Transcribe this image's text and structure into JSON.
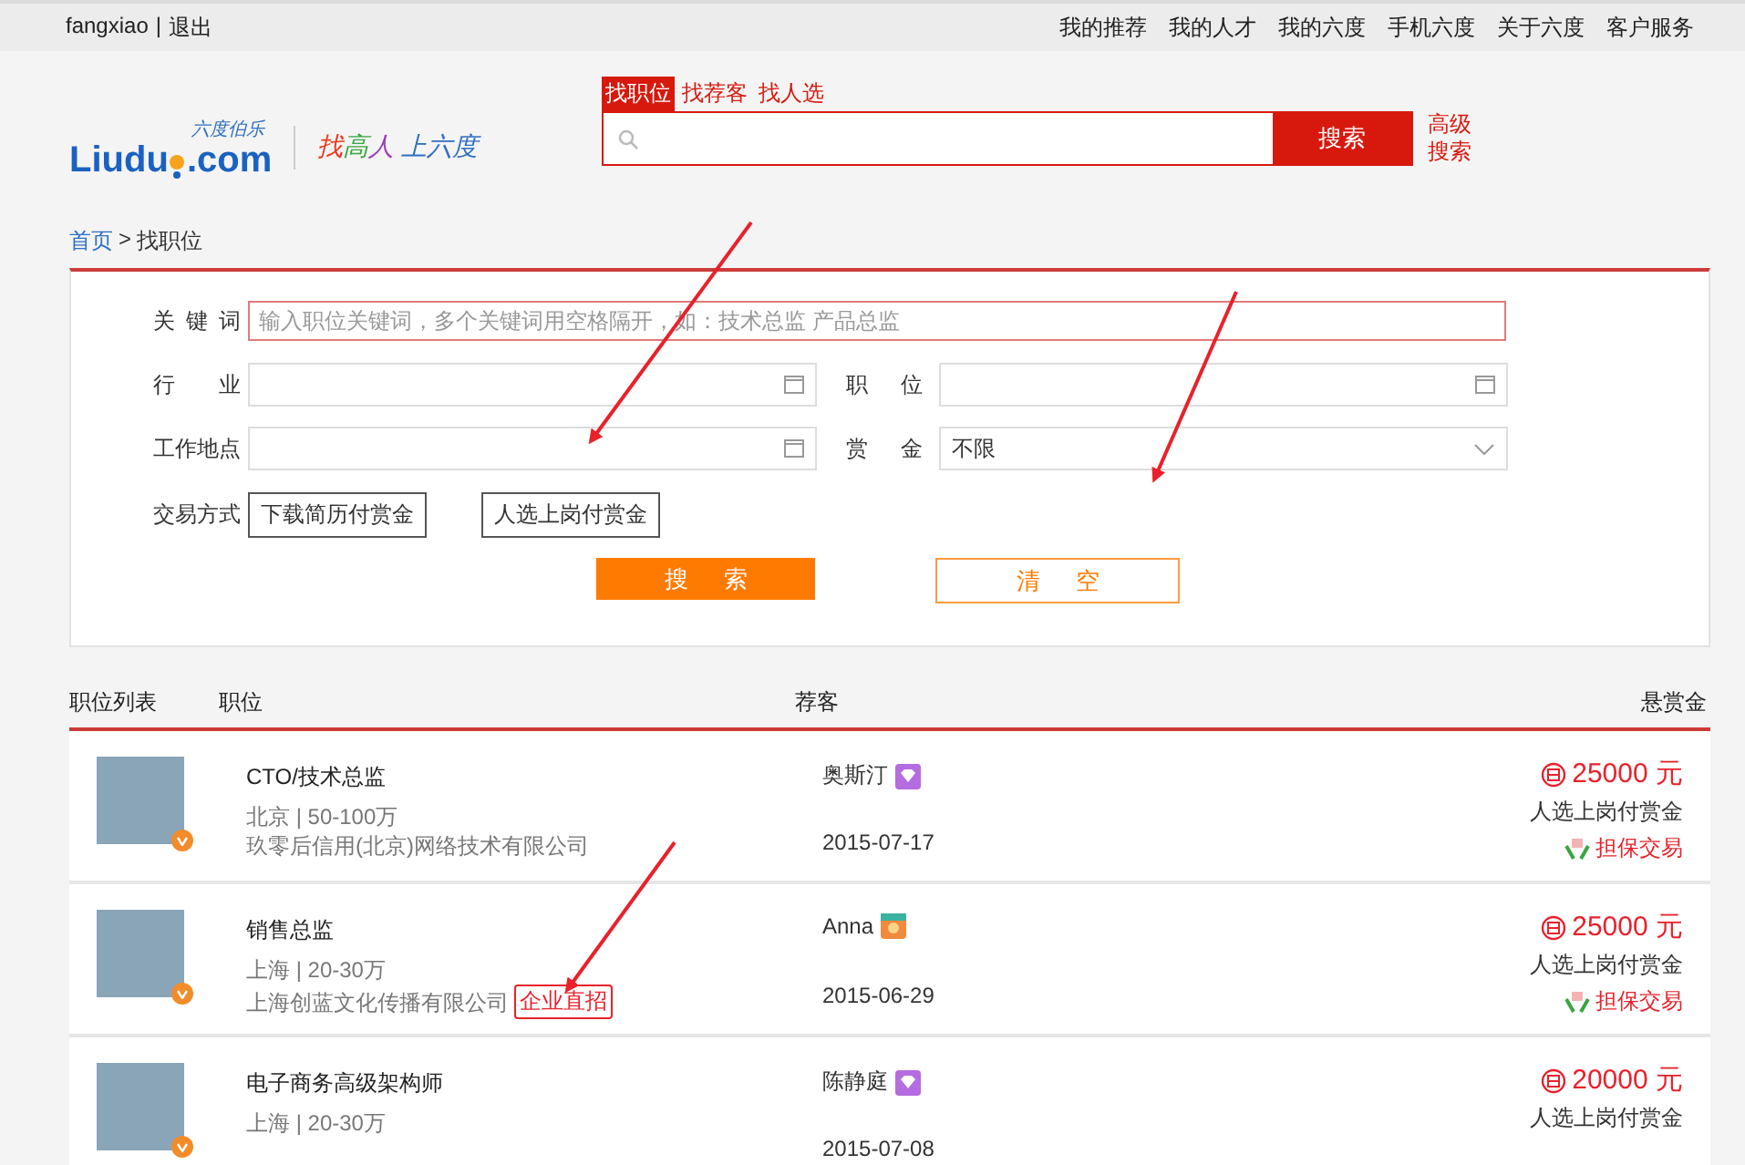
{
  "top_bar": {
    "user": "fangxiao",
    "separator": "|",
    "logout": "退出",
    "links": [
      "我的推荐",
      "我的人才",
      "我的六度",
      "手机六度",
      "关于六度",
      "客户服务"
    ]
  },
  "logo": {
    "small": "六度伯乐",
    "name": "Liudu",
    "suffix": ".com",
    "slogan": [
      {
        "text": "找",
        "color": "#e8391b"
      },
      {
        "text": "高",
        "color": "#3aa640"
      },
      {
        "text": "人",
        "color": "#9b3fb5"
      },
      {
        "text": " 上六度",
        "color": "#2f6fc0"
      }
    ]
  },
  "search": {
    "tabs": [
      {
        "label": "找职位",
        "selected": true
      },
      {
        "label": "找荐客",
        "selected": false
      },
      {
        "label": "找人选",
        "selected": false
      }
    ],
    "button": "搜索",
    "advanced": "高级搜索"
  },
  "breadcrumb": {
    "items": [
      "首页",
      "找职位"
    ],
    "separator": ">"
  },
  "filters": {
    "keyword": {
      "label": "关键词",
      "placeholder": "输入职位关键词，多个关键词用空格隔开，如：技术总监 产品总监"
    },
    "fields": [
      {
        "label": "行业",
        "kind": "picker"
      },
      {
        "label": "职位",
        "kind": "picker"
      },
      {
        "label": "工作地点",
        "kind": "picker"
      },
      {
        "label": "赏金",
        "kind": "select",
        "value": "不限"
      }
    ],
    "trade_label": "交易方式",
    "trade_options": [
      "下载简历付赏金",
      "人选上岗付赏金"
    ],
    "search_button": "搜索",
    "clear_button": "清空"
  },
  "list": {
    "columns": [
      "职位列表",
      "职位",
      "荐客",
      "悬赏金"
    ],
    "rows": [
      {
        "verified": true,
        "title": "CTO/技术总监",
        "meta": "北京 | 50-100万",
        "company": "玖零后信用(北京)网络技术有限公司",
        "recommender": "奥斯汀",
        "kind": "diamond",
        "date": "2015-07-17",
        "amount": "25000 元",
        "terms": "人选上岗付赏金",
        "guarantee": "担保交易"
      },
      {
        "verified": true,
        "title": "销售总监",
        "meta": "上海 | 20-30万",
        "company": "上海创蓝文化传播有限公司",
        "tag": "企业直招",
        "recommender": "Anna",
        "kind": "medal",
        "date": "2015-06-29",
        "amount": "25000 元",
        "terms": "人选上岗付赏金",
        "guarantee": "担保交易"
      },
      {
        "verified": true,
        "title": "电子商务高级架构师",
        "meta": "上海 | 20-30万",
        "recommender": "陈静庭",
        "kind": "diamond",
        "date": "2015-07-08",
        "amount": "20000 元",
        "terms": "人选上岗付赏金"
      }
    ]
  }
}
